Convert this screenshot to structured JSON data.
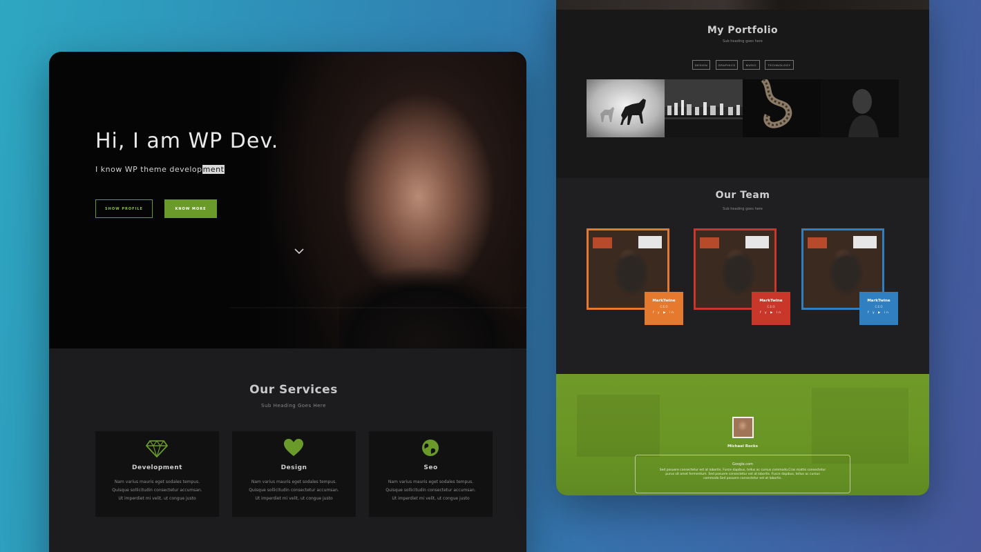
{
  "hero": {
    "title": "Hi, I am WP Dev.",
    "subtitle_text": "I know WP theme develop",
    "subtitle_highlight": "ment",
    "show_profile_label": "SHOW PROFILE",
    "know_more_label": "KNOW MORE"
  },
  "services": {
    "title": "Our Services",
    "subtitle": "Sub Heading Goes Here",
    "items": [
      {
        "icon": "diamond-icon",
        "title": "Development",
        "lines": [
          "Nam varius mauris eget sodales tempus.",
          "Quisque sollicitudin consectetur accumsan.",
          "Ut imperdiet mi velit, ut congue justo"
        ]
      },
      {
        "icon": "heart-icon",
        "title": "Design",
        "lines": [
          "Nam varius mauris eget sodales tempus.",
          "Quisque sollicitudin consectetur accumsan.",
          "Ut imperdiet mi velit, ut congue justo"
        ]
      },
      {
        "icon": "globe-icon",
        "title": "Seo",
        "lines": [
          "Nam varius mauris eget sodales tempus.",
          "Quisque sollicitudin consectetur accumsan.",
          "Ut imperdiet mi velit, ut congue justo"
        ]
      }
    ]
  },
  "portfolio": {
    "title": "My Portfolio",
    "subtitle": "Sub heading goes here",
    "filters": [
      "DESIGN",
      "GRAPHICS",
      "MUSIC",
      "TECHNOLOGY"
    ]
  },
  "team": {
    "title": "Our Team",
    "subtitle": "Sub heading goes here",
    "members": [
      {
        "name": "MarkTwine",
        "role": "C.E.O",
        "socials": "f y ▶ in",
        "color": "#e57a2e"
      },
      {
        "name": "MarkTwine",
        "role": "C.E.O",
        "socials": "f y ▶ in",
        "color": "#c9362a"
      },
      {
        "name": "MarkTwine",
        "role": "C.E.O",
        "socials": "f y ▶ in",
        "color": "#2f7fc1"
      }
    ]
  },
  "testimonial": {
    "name": "Michael Rocks",
    "site": "Google.com",
    "lines": [
      "Sed posuere consectetur est at lobortis. Fusce dapibus, tellus ac cursus commodo.Cras mattis consectetur",
      "purus sit amet fermentum. Sed posuere consectetur est at lobortis. Fusce dapibus, tellus ac cursus",
      "commodo.Sed posuere consectetur est at lobortis."
    ]
  },
  "colors": {
    "accent_green": "#6a9b2a",
    "member_orange": "#e57a2e",
    "member_red": "#c9362a",
    "member_blue": "#2f7fc1"
  }
}
